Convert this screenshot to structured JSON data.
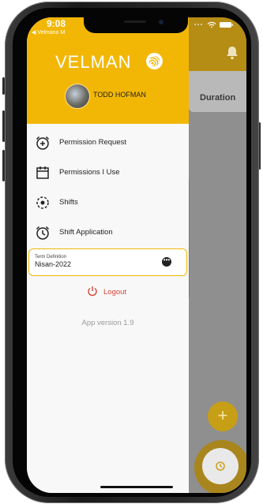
{
  "status_bar": {
    "time": "9:08",
    "back_app": "◀ Velmano M"
  },
  "background_app": {
    "column_header": "Duration",
    "fab_symbol": "+"
  },
  "drawer": {
    "brand": "VELMAN",
    "user_name": "TODD HOFMAN",
    "menu": [
      {
        "label": "Permission Request",
        "icon": "alarm-plus-icon"
      },
      {
        "label": "Permissions I Use",
        "icon": "calendar-icon"
      },
      {
        "label": "Shifts",
        "icon": "target-icon"
      },
      {
        "label": "Shift Application",
        "icon": "alarm-clock-icon"
      }
    ],
    "term": {
      "label": "Term Definition",
      "value": "Nisan-2022",
      "more": "•••"
    },
    "logout_label": "Logout",
    "app_version": "App version 1.9"
  },
  "colors": {
    "brand_yellow": "#f2b705",
    "logout_red": "#d9443a"
  }
}
